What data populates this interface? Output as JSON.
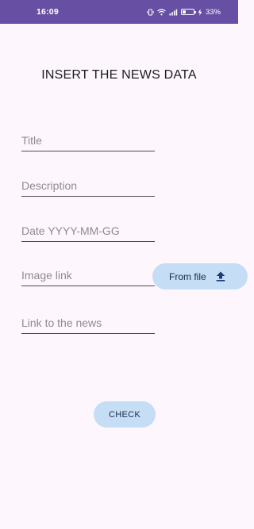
{
  "status_bar": {
    "time": "16:09",
    "battery_percent": "33%",
    "battery_level": 0.33,
    "icons": [
      "vibrate-icon",
      "wifi-icon",
      "signal-icon",
      "battery-icon",
      "charging-icon"
    ]
  },
  "form": {
    "title": "INSERT THE NEWS DATA",
    "fields": {
      "title": {
        "placeholder": "Title",
        "value": ""
      },
      "description": {
        "placeholder": "Description",
        "value": ""
      },
      "date": {
        "placeholder": "Date YYYY-MM-GG",
        "value": ""
      },
      "image_link": {
        "placeholder": "Image link",
        "value": ""
      },
      "news_link": {
        "placeholder": "Link to the news",
        "value": ""
      }
    },
    "from_file_button": {
      "label": "From file",
      "icon": "upload-icon"
    },
    "check_button": {
      "label": "CHECK"
    }
  },
  "colors": {
    "status_bar": "#6750A4",
    "background": "#FDF7FD",
    "button": "#C5DDF5",
    "button_text": "#1A2A4A",
    "upload_icon": "#1F3A7A"
  }
}
